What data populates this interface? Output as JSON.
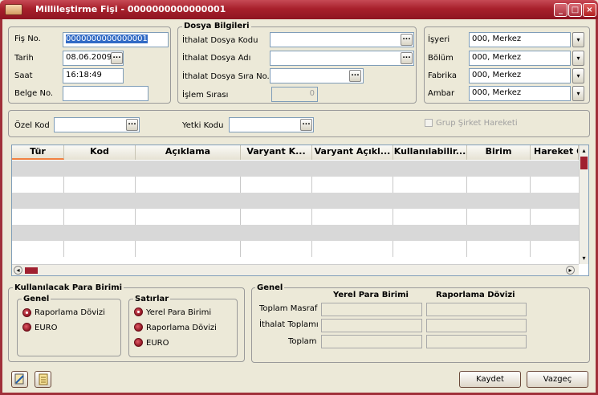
{
  "window": {
    "title": "Millileştirme Fişi - 0000000000000001",
    "minimize": "_",
    "maximize": "□",
    "close": "×"
  },
  "left": {
    "fis_no_label": "Fiş No.",
    "fis_no_value": "0000000000000001",
    "tarih_label": "Tarih",
    "tarih_value": "08.06.2009",
    "saat_label": "Saat",
    "saat_value": "16:18:49",
    "belge_no_label": "Belge No.",
    "belge_no_value": ""
  },
  "dosya": {
    "title": "Dosya Bilgileri",
    "kodu_label": "İthalat Dosya Kodu",
    "adi_label": "İthalat Dosya Adı",
    "sira_no_label": "İthalat Dosya Sıra No.",
    "islem_label": "İşlem Sırası",
    "islem_value": "0"
  },
  "right": {
    "isyeri_label": "İşyeri",
    "isyeri_value": "000, Merkez",
    "bolum_label": "Bölüm",
    "bolum_value": "000, Merkez",
    "fabrika_label": "Fabrika",
    "fabrika_value": "000, Merkez",
    "ambar_label": "Ambar",
    "ambar_value": "000, Merkez"
  },
  "row2": {
    "ozel_kod_label": "Özel Kod",
    "yetki_kodu_label": "Yetki Kodu",
    "grup_label": "Grup Şirket Hareketi"
  },
  "table": {
    "columns": [
      "Tür",
      "Kod",
      "Açıklama",
      "Varyant K...",
      "Varyant Açıkl...",
      "Kullanılabilir...",
      "Birim",
      "Hareket Ö"
    ]
  },
  "para": {
    "title": "Kullanılacak Para Birimi",
    "genel_title": "Genel",
    "genel_options": [
      "Raporlama Dövizi",
      "EURO"
    ],
    "satirlar_title": "Satırlar",
    "satirlar_options": [
      "Yerel Para Birimi",
      "Raporlama Dövizi",
      "EURO"
    ]
  },
  "genel": {
    "title": "Genel",
    "col_yerel": "Yerel Para Birimi",
    "col_rapor": "Raporlama Dövizi",
    "rows": [
      "Toplam Masraf",
      "İthalat Toplamı",
      "Toplam"
    ]
  },
  "buttons": {
    "kaydet": "Kaydet",
    "vazgec": "Vazgeç"
  },
  "icons": {
    "dots": "...",
    "dropdown": "▾",
    "left": "◂",
    "right": "▸",
    "up": "▴",
    "down": "▾"
  }
}
